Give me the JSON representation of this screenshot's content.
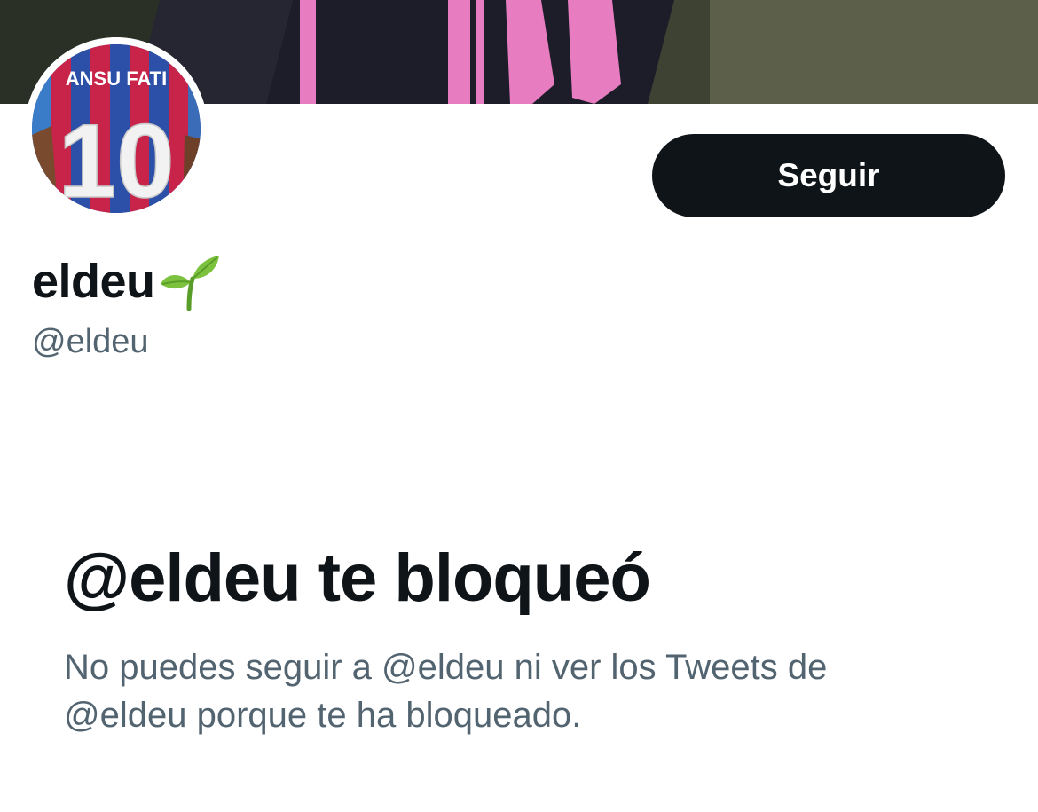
{
  "profile": {
    "display_name": "eldeu",
    "name_emoji": "seedling-emoji",
    "handle": "@eldeu",
    "avatar_jersey_name": "ANSU FATI",
    "avatar_jersey_number": "10"
  },
  "actions": {
    "follow_label": "Seguir"
  },
  "blocked": {
    "title": "@eldeu te bloqueó",
    "description": "No puedes seguir a @eldeu ni ver los Tweets de @eldeu porque te ha bloqueado."
  },
  "colors": {
    "text_primary": "#0f1419",
    "text_secondary": "#536471",
    "button_bg": "#0f1419",
    "button_text": "#ffffff",
    "background": "#ffffff",
    "jersey_pink": "#e77cc0"
  }
}
